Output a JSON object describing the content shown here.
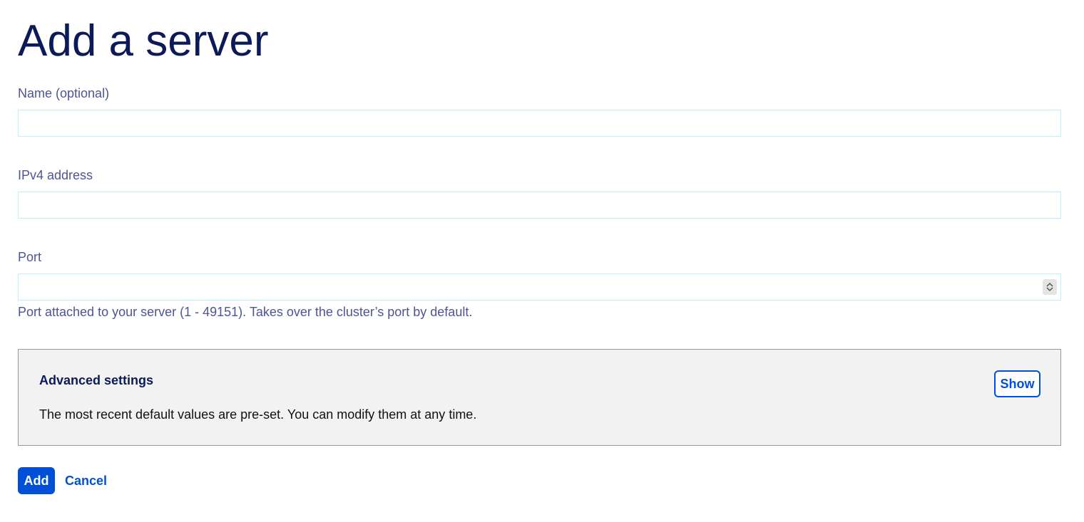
{
  "page": {
    "title": "Add a server"
  },
  "form": {
    "name": {
      "label": "Name (optional)",
      "value": "",
      "placeholder": ""
    },
    "ipv4": {
      "label": "IPv4 address",
      "value": "",
      "placeholder": ""
    },
    "port": {
      "label": "Port",
      "value": "",
      "placeholder": "",
      "helper": "Port attached to your server (1 - 49151). Takes over the cluster’s port by default."
    }
  },
  "advanced": {
    "title": "Advanced settings",
    "description": "The most recent default values are pre-set. You can modify them at any time.",
    "show_label": "Show"
  },
  "actions": {
    "add_label": "Add",
    "cancel_label": "Cancel"
  },
  "colors": {
    "primary": "#0050d7",
    "heading": "#0c1a5a",
    "label": "#4d5592",
    "input_border": "#bef1f6",
    "panel_bg": "#f2f2f2"
  },
  "icons": {
    "port_spinner": "spinner-arrows-icon"
  }
}
